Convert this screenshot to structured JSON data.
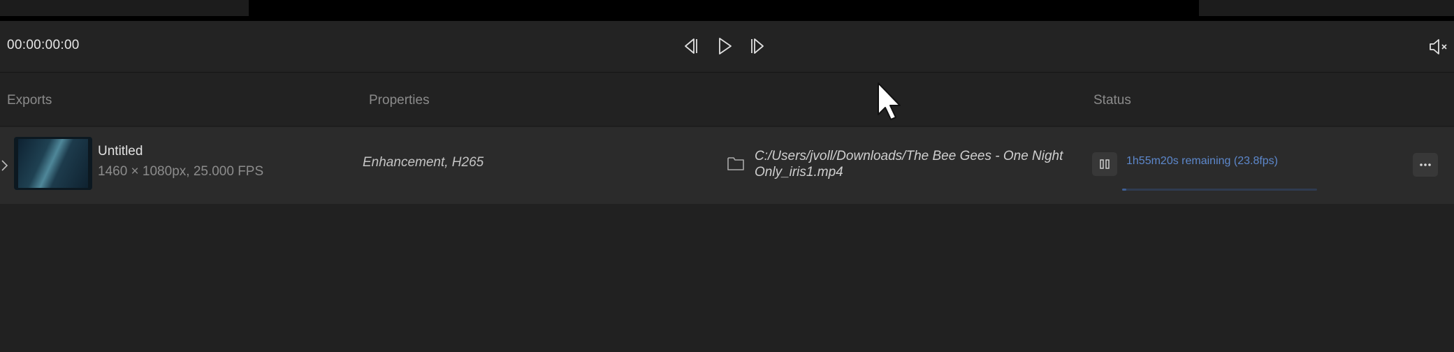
{
  "transport": {
    "timecode": "00:00:00:00"
  },
  "columns": {
    "exports": "Exports",
    "properties": "Properties",
    "status": "Status"
  },
  "export_item": {
    "title": "Untitled",
    "meta": "1460 × 1080px, 25.000 FPS",
    "properties": "Enhancement, H265",
    "path": "C:/Users/jvoll/Downloads/The Bee Gees - One Night Only_iris1.mp4",
    "status": "1h55m20s remaining (23.8fps)",
    "progress_fraction": 0.02
  },
  "icons": {
    "prev": "skip-back-icon",
    "play": "play-icon",
    "next": "skip-forward-icon",
    "mute": "speaker-muted-icon",
    "folder": "folder-icon",
    "pause": "pause-icon",
    "more": "more-horizontal-icon",
    "expand": "chevron-right-icon"
  },
  "colors": {
    "background": "#212121",
    "row": "#2b2b2b",
    "accent": "#5d88cc"
  }
}
